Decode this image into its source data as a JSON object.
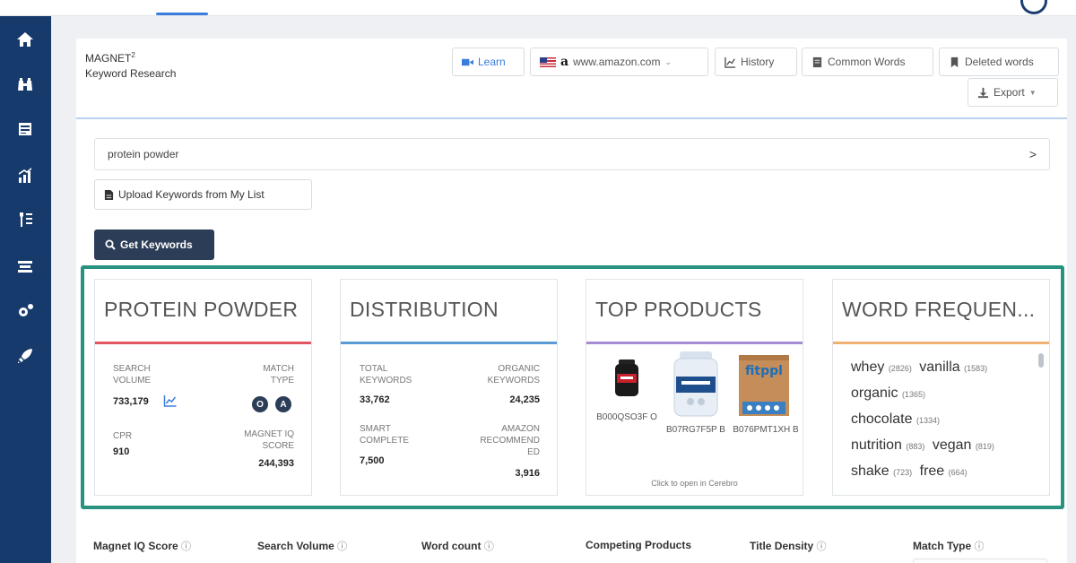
{
  "brand": {
    "name": "MAGNET",
    "superscript": "2",
    "subtitle": "Keyword Research"
  },
  "toolbar": {
    "learn": "Learn",
    "marketplace": "www.amazon.com",
    "history": "History",
    "common_words": "Common Words",
    "deleted_words": "Deleted words",
    "export": "Export"
  },
  "search": {
    "value": "protein powder",
    "chevron": ">"
  },
  "upload_label": "Upload Keywords from My List",
  "get_keywords_label": "Get Keywords",
  "cards": {
    "keyword": {
      "title": "PROTEIN POWDER",
      "search_volume_label": "SEARCH VOLUME",
      "search_volume": "733,179",
      "match_type_label": "MATCH TYPE",
      "match_badges": [
        "O",
        "A"
      ],
      "cpr_label": "CPR",
      "cpr": "910",
      "iq_label": "MAGNET IQ SCORE",
      "iq": "244,393",
      "accent": "#e0555f"
    },
    "distribution": {
      "title": "DISTRIBUTION",
      "total_label": "TOTAL KEYWORDS",
      "total": "33,762",
      "organic_label": "ORGANIC KEYWORDS",
      "organic": "24,235",
      "smart_label": "SMART COMPLETE",
      "smart": "7,500",
      "amazon_label": "AMAZON RECOMMEND ED",
      "amazon": "3,916",
      "accent": "#5b9bd5"
    },
    "top_products": {
      "title": "TOP PRODUCTS",
      "products": [
        {
          "asin": "B000QSO3F O"
        },
        {
          "asin": "B07RG7F5P B"
        },
        {
          "asin": "B076PMT1XH B"
        }
      ],
      "footer": "Click to open in Cerebro",
      "accent": "#a58bd4"
    },
    "word_frequency": {
      "title": "WORD FREQUEN...",
      "words": [
        {
          "word": "whey",
          "count": "(2826)"
        },
        {
          "word": "vanilla",
          "count": "(1583)"
        },
        {
          "word": "organic",
          "count": "(1365)"
        },
        {
          "word": "chocolate",
          "count": "(1334)"
        },
        {
          "word": "nutrition",
          "count": "(883)"
        },
        {
          "word": "vegan",
          "count": "(819)"
        },
        {
          "word": "shake",
          "count": "(723)"
        },
        {
          "word": "free",
          "count": "(664)"
        }
      ],
      "accent": "#f0b073"
    }
  },
  "columns": [
    "Magnet IQ Score",
    "Search Volume",
    "Word count",
    "Competing Products",
    "Title Density",
    "Match Type"
  ],
  "help_glyph": "ⓘ"
}
